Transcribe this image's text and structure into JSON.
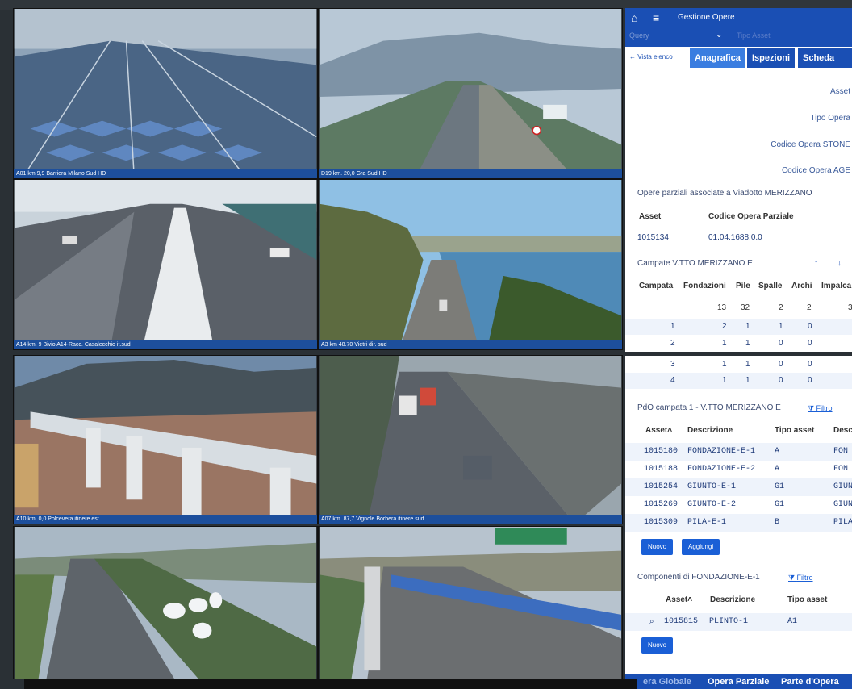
{
  "cameras": [
    {
      "caption": "A01 km 9,9 Barriera Milano Sud HD"
    },
    {
      "caption": "D19 km. 20,0 Gra Sud HD"
    },
    {
      "caption": "A14 km. 9 Bivio A14-Racc. Casalecchio it.sud"
    },
    {
      "caption": "A3 km 48.70 Vietri dir. sud"
    },
    {
      "caption": "A10 km. 0,0 Polcevera itinere est"
    },
    {
      "caption": "A07 km. 87,7 Vignole Borbera itinere sud"
    },
    {
      "caption": ""
    },
    {
      "caption": ""
    }
  ],
  "header": {
    "title": "Gestione Opere"
  },
  "search": {
    "query_label": "Query",
    "tipo_label": "Tipo Asset"
  },
  "tabs": {
    "back": "Vista elenco",
    "anagrafica": "Anagrafica",
    "ispezioni": "Ispezioni",
    "scheda": "Scheda Dife"
  },
  "form": {
    "asset": "Asset",
    "tipo_opera": "Tipo Opera",
    "codice_stone": "Codice Opera STONE",
    "codice_age": "Codice Opera AGE"
  },
  "parziali": {
    "title": "Opere parziali associate a Viadotto MERIZZANO",
    "col_asset": "Asset",
    "col_codice": "Codice Opera Parziale",
    "asset": "1015134",
    "codice": "01.04.1688.0.0"
  },
  "campate": {
    "title": "Campate V.TTO MERIZZANO E",
    "headers": [
      "Campata",
      "Fondazioni",
      "Pile",
      "Spalle",
      "Archi",
      "Impalca"
    ],
    "totals": [
      "",
      "13",
      "32",
      "2",
      "2",
      "3"
    ],
    "rows": [
      [
        "1",
        "2",
        "1",
        "1",
        "0"
      ],
      [
        "2",
        "1",
        "1",
        "0",
        "0"
      ],
      [
        "3",
        "1",
        "1",
        "0",
        "0"
      ],
      [
        "4",
        "1",
        "1",
        "0",
        "0"
      ]
    ]
  },
  "pdo": {
    "title": "PdO campata 1 - V.TTO MERIZZANO E",
    "filter": "Filtro",
    "headers": [
      "Asset",
      "Descrizione",
      "Tipo asset",
      "Desc"
    ],
    "rows": [
      [
        "1015180",
        "FONDAZIONE-E-1",
        "A",
        "FON"
      ],
      [
        "1015188",
        "FONDAZIONE-E-2",
        "A",
        "FON"
      ],
      [
        "1015254",
        "GIUNTO-E-1",
        "G1",
        "GIUN"
      ],
      [
        "1015269",
        "GIUNTO-E-2",
        "G1",
        "GIUN"
      ],
      [
        "1015309",
        "PILA-E-1",
        "B",
        "PILA"
      ]
    ],
    "btn_new": "Nuovo",
    "btn_add": "Aggiungi"
  },
  "componenti": {
    "title": "Componenti di FONDAZIONE-E-1",
    "filter": "Filtro",
    "headers": [
      "Asset",
      "Descrizione",
      "Tipo asset"
    ],
    "row": [
      "1015815",
      "PLINTO-1",
      "A1"
    ],
    "btn_new": "Nuovo"
  },
  "bottom_tabs": [
    "era Globale",
    "Opera Parziale",
    "Parte d'Opera"
  ],
  "colors": {
    "accent": "#1a4fb4",
    "caption": "#1d4f9c"
  }
}
